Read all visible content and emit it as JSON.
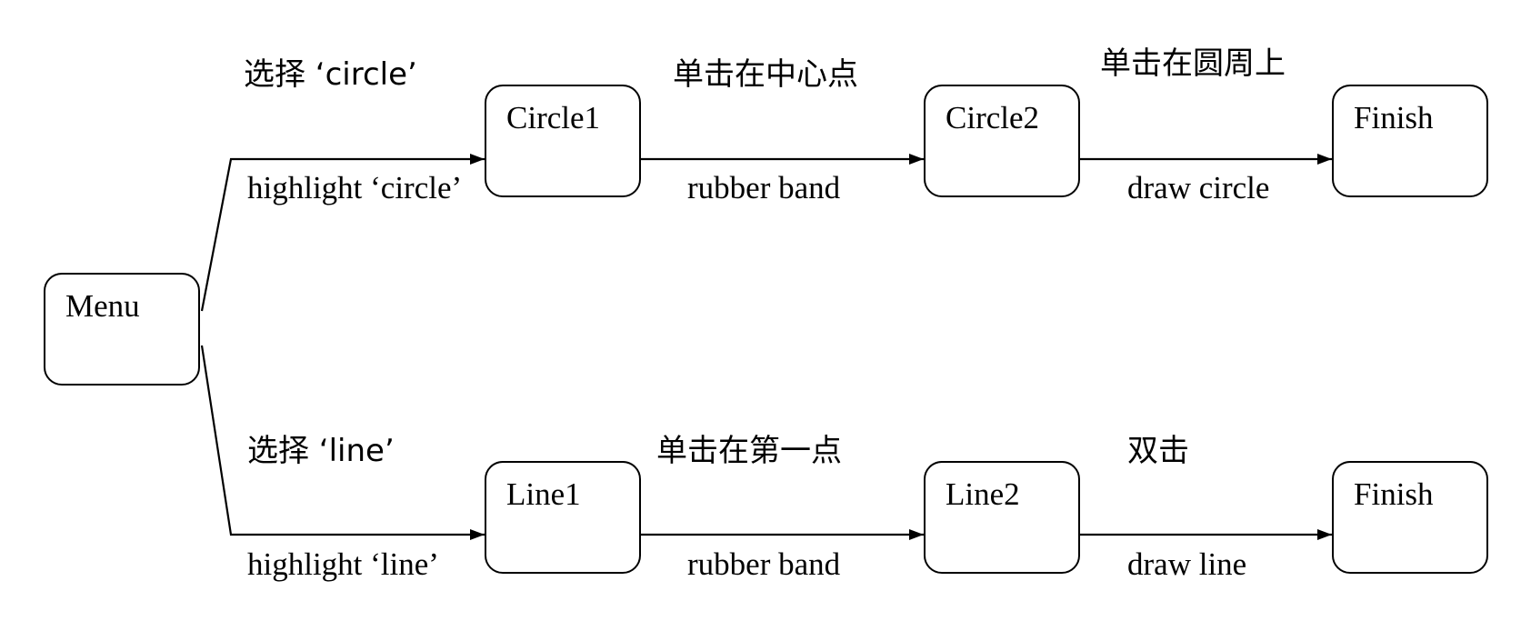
{
  "states": {
    "menu": "Menu",
    "circle1": "Circle1",
    "circle2": "Circle2",
    "circle_finish": "Finish",
    "line1": "Line1",
    "line2": "Line2",
    "line_finish": "Finish"
  },
  "circle_path": {
    "menu_to_circle1": {
      "event": "选择 ‘circle’",
      "action": "highlight ‘circle’"
    },
    "circle1_to_circle2": {
      "event": "单击在中心点",
      "action": "rubber band"
    },
    "circle2_to_finish": {
      "event": "单击在圆周上",
      "action": "draw circle"
    }
  },
  "line_path": {
    "menu_to_line1": {
      "event": "选择 ‘line’",
      "action": "highlight ‘line’"
    },
    "line1_to_line2": {
      "event": "单击在第一点",
      "action": "rubber band"
    },
    "line2_to_finish": {
      "event": "双击",
      "action": "draw line"
    }
  },
  "colors": {
    "stroke": "#000000",
    "background": "#ffffff"
  }
}
